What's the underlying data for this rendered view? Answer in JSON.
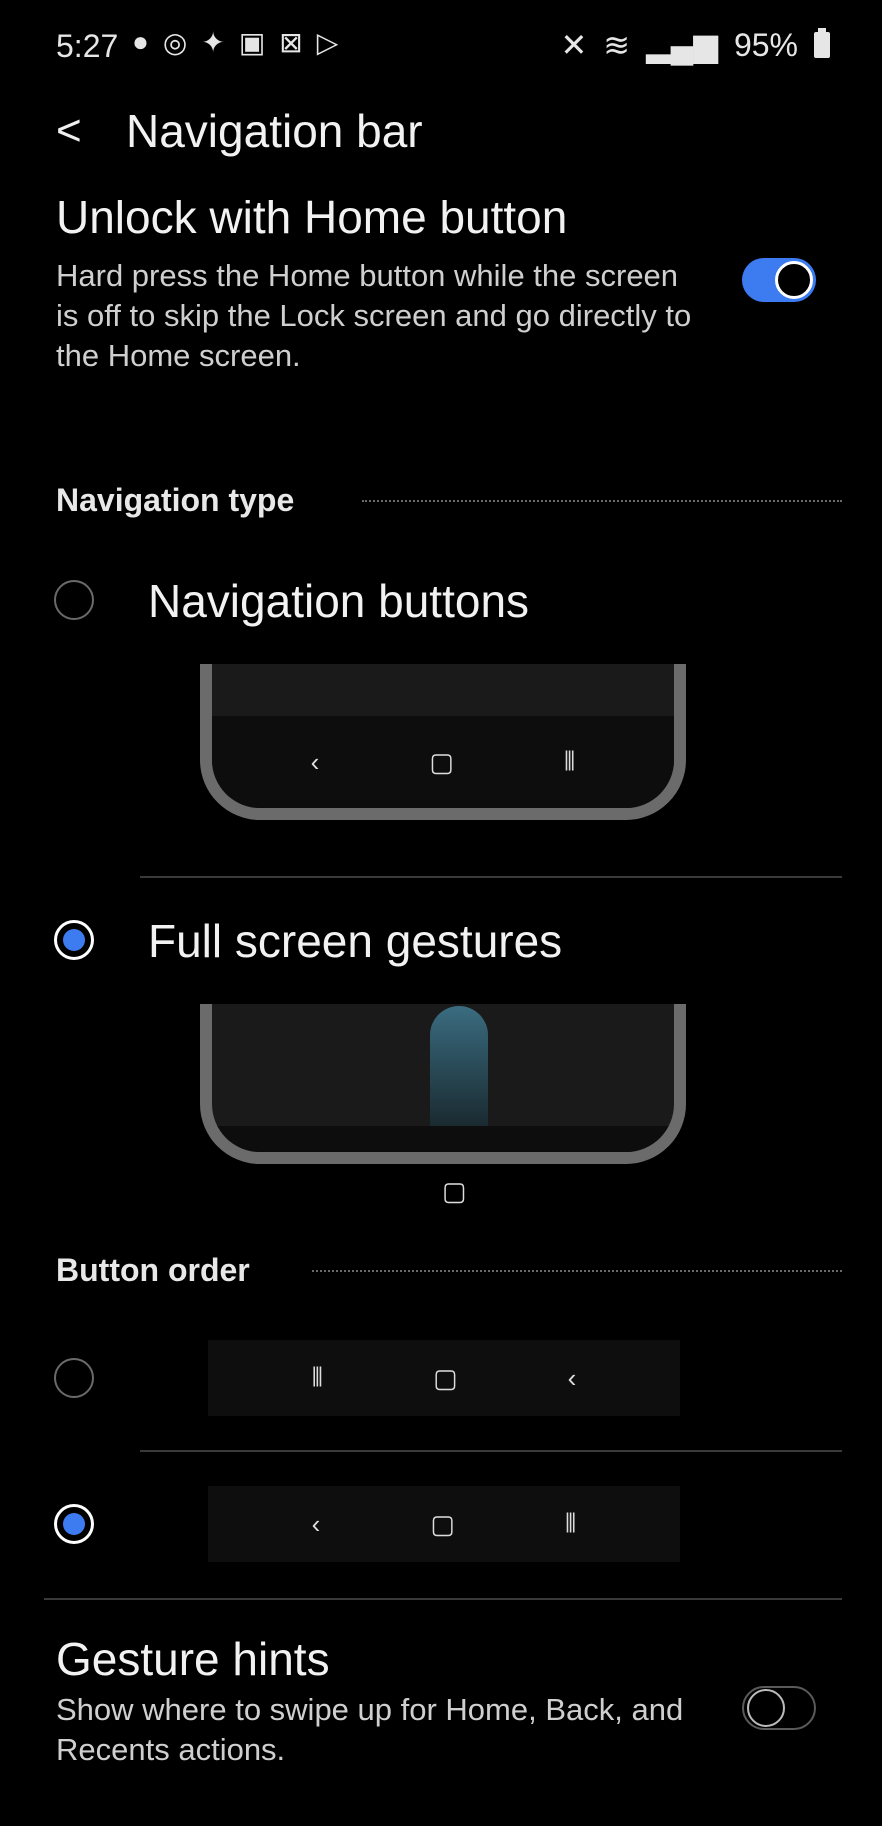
{
  "status_bar": {
    "time": "5:27",
    "left_icons": [
      "messenger-icon",
      "whatsapp-icon",
      "twitter-icon",
      "gallery-icon",
      "close-box-icon",
      "play-store-icon"
    ],
    "battery": "95%"
  },
  "header": {
    "back_glyph": "<",
    "title": "Navigation bar"
  },
  "unlock": {
    "title": "Unlock with Home button",
    "description": "Hard press the Home button while the screen is off to skip the Lock screen and go directly to the Home screen.",
    "enabled": true
  },
  "navigation_type": {
    "header": "Navigation type",
    "options": [
      {
        "label": "Navigation buttons",
        "selected": false
      },
      {
        "label": "Full screen gestures",
        "selected": true
      }
    ],
    "nav_glyphs": [
      "‹",
      "▢",
      "⦀"
    ]
  },
  "button_order": {
    "header": "Button order",
    "options": [
      {
        "glyphs": [
          "⦀",
          "▢",
          "‹"
        ],
        "selected": false
      },
      {
        "glyphs": [
          "‹",
          "▢",
          "⦀"
        ],
        "selected": true
      }
    ]
  },
  "gesture_hints": {
    "title": "Gesture hints",
    "description": "Show where to swipe up for Home, Back, and Recents actions.",
    "enabled": false
  },
  "colors": {
    "accent": "#3d7bf0",
    "background": "#000000"
  }
}
